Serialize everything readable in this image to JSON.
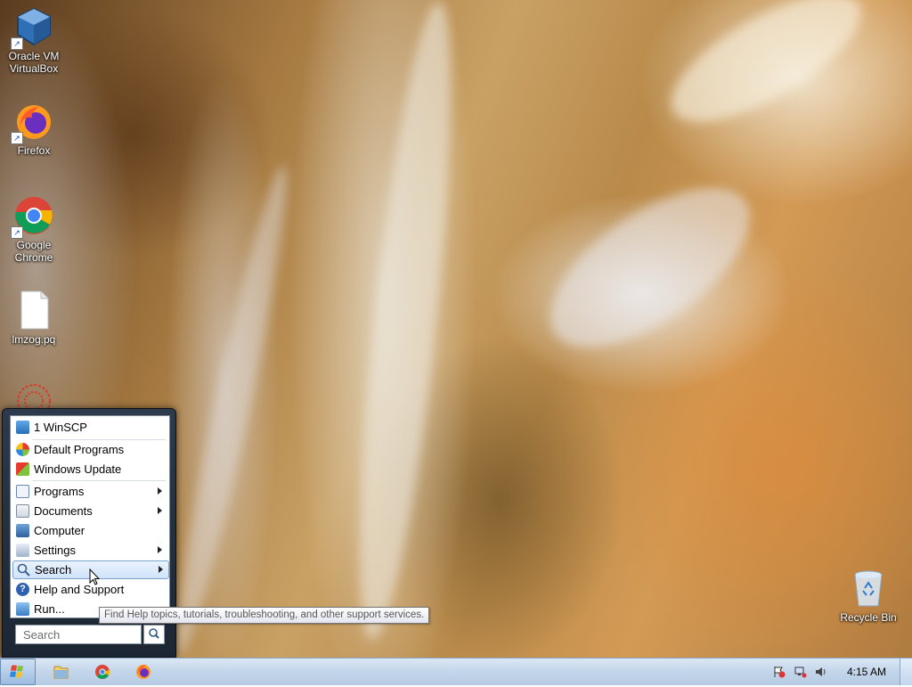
{
  "desktop": {
    "icons": [
      {
        "label_line1": "Oracle VM",
        "label_line2": "VirtualBox",
        "icon": "virtualbox-icon"
      },
      {
        "label_line1": "Firefox",
        "label_line2": "",
        "icon": "firefox-icon"
      },
      {
        "label_line1": "Google",
        "label_line2": "Chrome",
        "icon": "chrome-icon"
      },
      {
        "label_line1": "lmzog.pq",
        "label_line2": "",
        "icon": "file-icon"
      },
      {
        "label_line1": "Recycle Bin",
        "label_line2": "",
        "icon": "recycle-bin-icon"
      }
    ]
  },
  "start_menu": {
    "items": [
      {
        "label": "1 WinSCP",
        "icon": "winscp-icon",
        "submenu": false
      },
      {
        "label": "Default Programs",
        "icon": "default-programs-icon",
        "submenu": false
      },
      {
        "label": "Windows Update",
        "icon": "windows-update-icon",
        "submenu": false
      },
      {
        "label": "Programs",
        "icon": "programs-icon",
        "submenu": true
      },
      {
        "label": "Documents",
        "icon": "documents-icon",
        "submenu": true
      },
      {
        "label": "Computer",
        "icon": "computer-icon",
        "submenu": false
      },
      {
        "label": "Settings",
        "icon": "settings-icon",
        "submenu": true
      },
      {
        "label": "Search",
        "icon": "search-icon",
        "submenu": true,
        "highlighted": true
      },
      {
        "label": "Help and Support",
        "icon": "help-icon",
        "submenu": false
      },
      {
        "label": "Run...",
        "icon": "run-icon",
        "submenu": false
      }
    ],
    "search_placeholder": "Search"
  },
  "tooltip": {
    "text": "Find Help topics, tutorials, troubleshooting, and other support services."
  },
  "taskbar": {
    "pinned": [
      {
        "name": "explorer",
        "icon": "folder-icon"
      },
      {
        "name": "chrome",
        "icon": "chrome-icon"
      },
      {
        "name": "firefox",
        "icon": "firefox-icon"
      }
    ],
    "tray_icons": [
      "action-center-flag-icon",
      "network-icon",
      "volume-icon"
    ],
    "clock": "4:15 AM"
  }
}
